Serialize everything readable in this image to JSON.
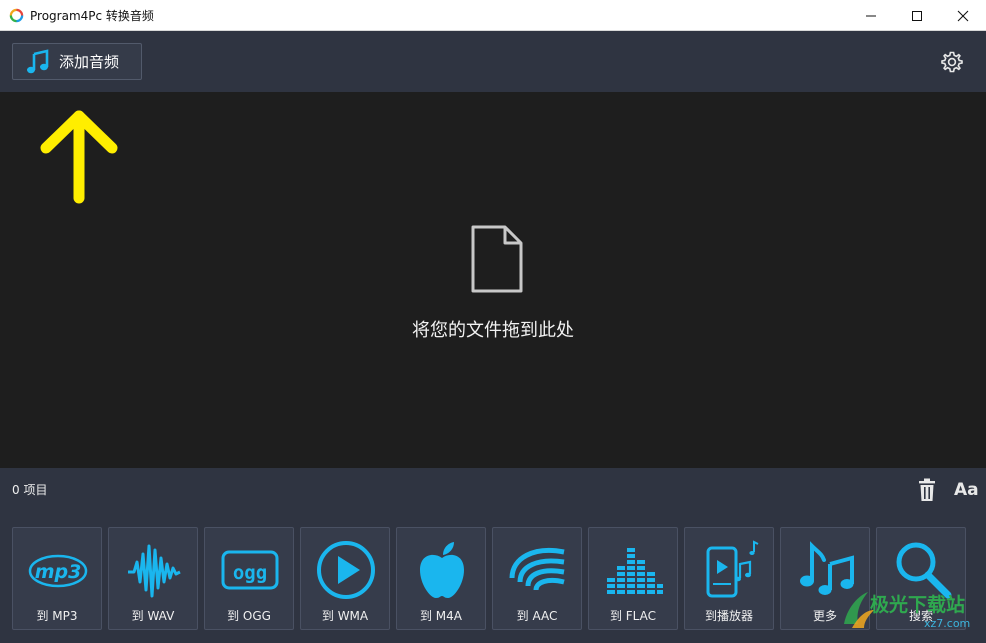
{
  "window": {
    "title": "Program4Pc 转换音频"
  },
  "toolbar": {
    "add_label": "添加音频"
  },
  "dropzone": {
    "text": "将您的文件拖到此处"
  },
  "status": {
    "count": "0 项目",
    "font_glyph": "Aa"
  },
  "tiles": [
    {
      "label": "到 MP3",
      "icon": "mp3-icon"
    },
    {
      "label": "到 WAV",
      "icon": "waveform-icon"
    },
    {
      "label": "到 OGG",
      "icon": "ogg-icon"
    },
    {
      "label": "到 WMA",
      "icon": "play-circle-icon"
    },
    {
      "label": "到 M4A",
      "icon": "apple-icon"
    },
    {
      "label": "到 AAC",
      "icon": "aac-wave-icon"
    },
    {
      "label": "到 FLAC",
      "icon": "equalizer-icon"
    },
    {
      "label": "到播放器",
      "icon": "player-device-icon"
    },
    {
      "label": "更多",
      "icon": "music-notes-icon"
    },
    {
      "label": "搜索",
      "icon": "search-icon"
    }
  ],
  "colors": {
    "accent": "#1ab6ee",
    "toolbar_bg": "#2f3441",
    "content_bg": "#1e1e1e",
    "arrow": "#ffee00"
  },
  "watermark": {
    "text": "极光下载站",
    "sub": "xz7.com"
  }
}
